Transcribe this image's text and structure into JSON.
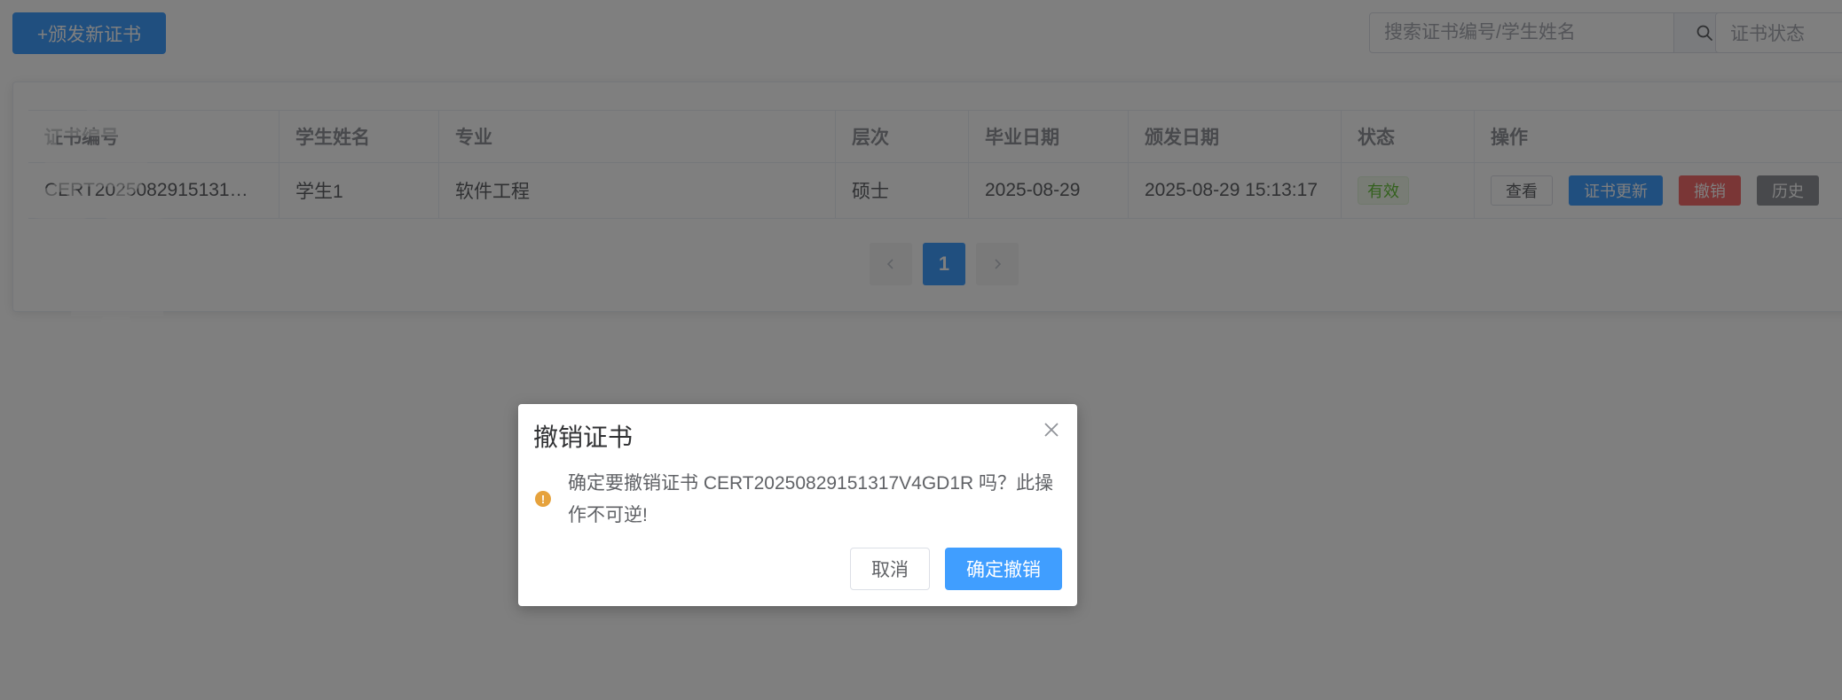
{
  "toolbar": {
    "issue_button_label": "+颁发新证书",
    "search_placeholder": "搜索证书编号/学生姓名",
    "status_select_placeholder": "证书状态"
  },
  "table": {
    "columns": [
      "证书编号",
      "学生姓名",
      "专业",
      "层次",
      "毕业日期",
      "颁发日期",
      "状态",
      "操作"
    ],
    "rows": [
      {
        "cert_no": "CERT2025082915131…",
        "student_name": "学生1",
        "major": "软件工程",
        "level": "硕士",
        "graduation_date": "2025-08-29",
        "issue_date": "2025-08-29 15:13:17",
        "status": "有效",
        "actions": {
          "view": "查看",
          "renew": "证书更新",
          "revoke": "撤销",
          "history": "历史"
        }
      }
    ]
  },
  "pagination": {
    "prev_icon": "chevron-left-icon",
    "current_page": "1",
    "next_icon": "chevron-right-icon"
  },
  "watermark": {
    "text": "夏沫mds"
  },
  "dialog": {
    "title": "撤销证书",
    "message": "确定要撤销证书 CERT20250829151317V4GD1R 吗？此操作不可逆!",
    "cancel_label": "取消",
    "confirm_label": "确定撤销",
    "warning_glyph": "!"
  },
  "colors": {
    "primary": "#409eff",
    "danger": "#f56c6c",
    "info": "#909399",
    "success": "#67c23a",
    "warning": "#e6a23c"
  }
}
